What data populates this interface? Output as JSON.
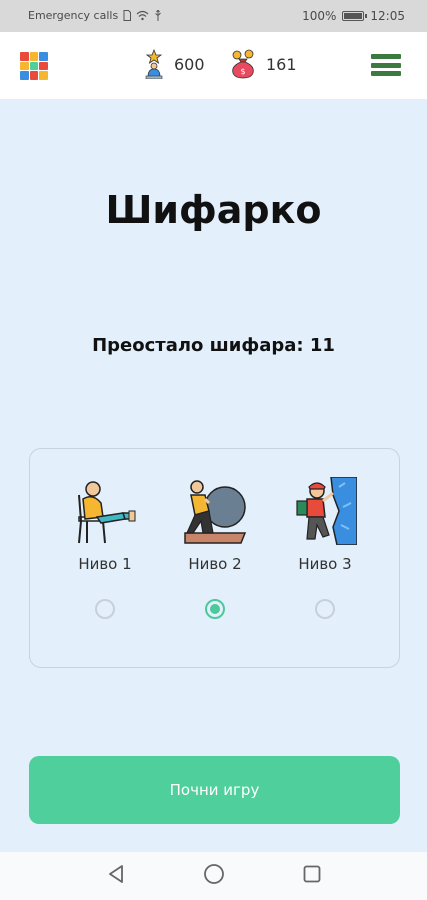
{
  "status_bar": {
    "carrier_text": "Emergency calls",
    "battery_text": "100%",
    "battery_level": 1.0,
    "time": "12:05"
  },
  "header": {
    "logo_icon": "color-grid-logo-icon",
    "stars_icon": "trophy-person-icon",
    "stars_count": "600",
    "coins_icon": "money-bag-icon",
    "coins_count": "161",
    "menu_icon": "hamburger-menu-icon"
  },
  "main": {
    "title": "Шифарко",
    "remaining_label": "Преостало шифара: 11"
  },
  "levels": [
    {
      "label": "Ниво 1",
      "icon": "relaxed-person-chair-icon",
      "selected": false
    },
    {
      "label": "Ниво 2",
      "icon": "person-pushing-boulder-icon",
      "selected": true
    },
    {
      "label": "Ниво 3",
      "icon": "rock-climber-icon",
      "selected": false
    }
  ],
  "start_button": {
    "label": "Почни игру"
  },
  "colors": {
    "background": "#e3f0fc",
    "accent_green": "#4ecf9b",
    "menu_green": "#3d7a3f"
  },
  "nav_bar": {
    "back_icon": "back-triangle-icon",
    "home_icon": "home-circle-icon",
    "recents_icon": "recents-square-icon"
  }
}
